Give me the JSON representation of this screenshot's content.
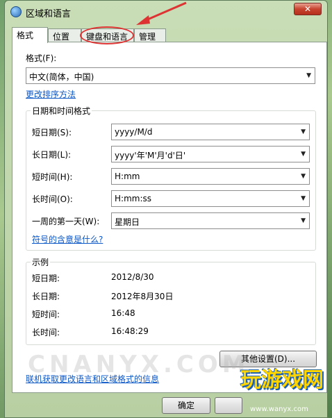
{
  "window": {
    "title": "区域和语言",
    "close_glyph": "✕"
  },
  "tabs": [
    {
      "label": "格式",
      "active": true
    },
    {
      "label": "位置",
      "active": false
    },
    {
      "label": "键盘和语言",
      "active": false
    },
    {
      "label": "管理",
      "active": false
    }
  ],
  "format": {
    "label": "格式(F):",
    "value": "中文(简体，中国)",
    "sort_link": "更改排序方法"
  },
  "datetime_group": {
    "title": "日期和时间格式",
    "rows": [
      {
        "label": "短日期(S):",
        "value": "yyyy/M/d"
      },
      {
        "label": "长日期(L):",
        "value": "yyyy'年'M'月'd'日'"
      },
      {
        "label": "短时间(H):",
        "value": "H:mm"
      },
      {
        "label": "长时间(O):",
        "value": "H:mm:ss"
      },
      {
        "label": "一周的第一天(W):",
        "value": "星期日"
      }
    ],
    "notation_link": "符号的含意是什么?"
  },
  "examples_group": {
    "title": "示例",
    "rows": [
      {
        "label": "短日期:",
        "value": "2012/8/30"
      },
      {
        "label": "长日期:",
        "value": "2012年8月30日"
      },
      {
        "label": "短时间:",
        "value": "16:48"
      },
      {
        "label": "长时间:",
        "value": "16:48:29"
      }
    ]
  },
  "other_settings_button": "其他设置(D)...",
  "online_link": "联机获取更改语言和区域格式的信息",
  "ok_button": "确定",
  "watermark": {
    "brand": "玩游戏网",
    "url": "www.wanyx.com",
    "ghost": "CNANYX.COM"
  },
  "colors": {
    "link": "#0b57c8",
    "annotation": "#dd3333",
    "watermark": "#ffd400"
  }
}
